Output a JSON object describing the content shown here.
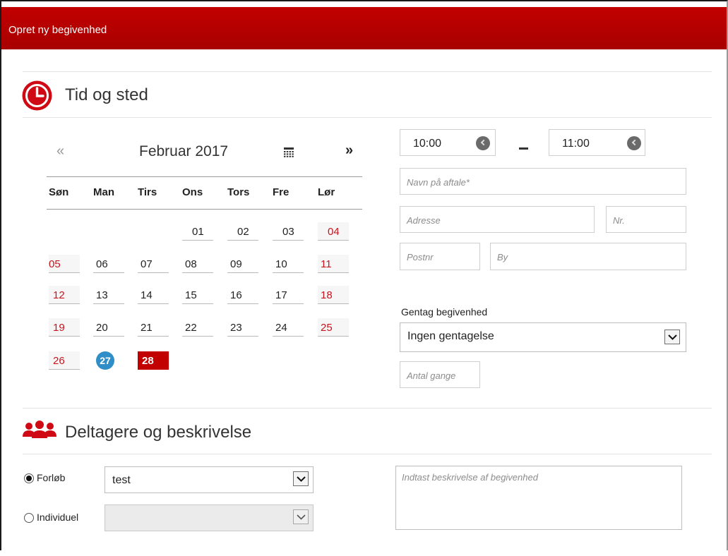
{
  "window": {
    "title": "Opret ny begivenhed",
    "accent": "#b30000"
  },
  "time_place": {
    "heading": "Tid og sted",
    "icon": "clock-icon"
  },
  "calendar": {
    "prev_label": "«",
    "next_label": "»",
    "month_label": "Februar 2017",
    "picker_icon": "calendar-grid-icon",
    "weekdays": [
      "Søn",
      "Man",
      "Tirs",
      "Ons",
      "Tors",
      "Fre",
      "Lør"
    ],
    "days": [
      "01",
      "02",
      "03",
      "04",
      "05",
      "06",
      "07",
      "08",
      "09",
      "10",
      "11",
      "12",
      "13",
      "14",
      "15",
      "16",
      "17",
      "18",
      "19",
      "20",
      "21",
      "22",
      "23",
      "24",
      "25",
      "26",
      "27",
      "28"
    ],
    "today": "27",
    "selected": "28",
    "weekend_color": "#c8141e",
    "today_color": "#2f8ec8",
    "selected_color": "#c30000"
  },
  "time": {
    "start": "10:00",
    "end": "11:00",
    "separator": "–"
  },
  "fields": {
    "name_placeholder": "Navn på aftale*",
    "address_placeholder": "Adresse",
    "number_placeholder": "Nr.",
    "postal_placeholder": "Postnr",
    "city_placeholder": "By"
  },
  "repeat": {
    "label": "Gentag begivenhed",
    "selected": "Ingen gentagelse",
    "count_placeholder": "Antal gange"
  },
  "participants": {
    "heading": "Deltagere og beskrivelse",
    "icon": "people-icon",
    "option_course": "Forløb",
    "option_individual": "Individuel",
    "course_value": "test",
    "individual_value": "",
    "selected_option": "Forløb"
  },
  "description": {
    "placeholder": "Indtast beskrivelse af begivenhed"
  }
}
